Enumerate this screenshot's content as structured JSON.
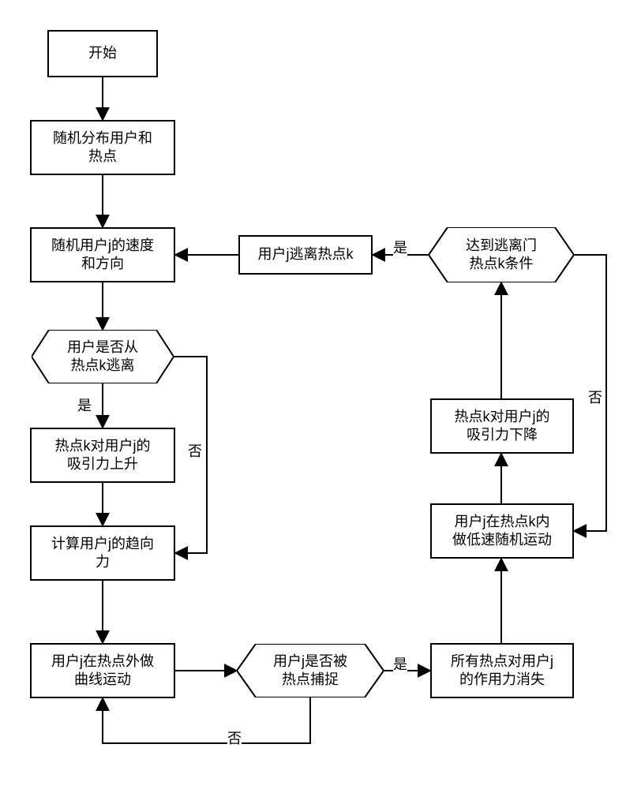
{
  "nodes": {
    "start": "开始",
    "distribute": "随机分布用户和\n热点",
    "speed_dir": "随机用户j的速度\n和方向",
    "dec_escape_from_k": "用户是否从\n热点k逃离",
    "attract_up": "热点k对用户j的\n吸引力上升",
    "calc_tendency": "计算用户j的趋向\n力",
    "curve_motion": "用户j在热点外做\n曲线运动",
    "dec_captured": "用户j是否被\n热点捕捉",
    "forces_gone": "所有热点对用户j\n的作用力消失",
    "low_speed": "用户j在热点k内\n做低速随机运动",
    "attract_down": "热点k对用户j的\n吸引力下降",
    "dec_reach_escape": "达到逃离门\n热点k条件",
    "escape_k": "用户j逃离热点k"
  },
  "labels": {
    "yes": "是",
    "no": "否"
  }
}
